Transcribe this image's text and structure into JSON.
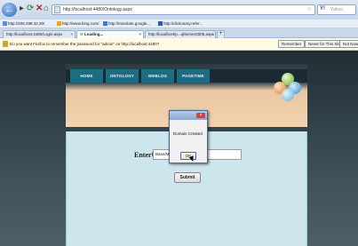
{
  "browser": {
    "url": "http://localhost:4480/Ontology.aspx",
    "search_placeholder": "Yahoo",
    "bookmarks": [
      {
        "label": "http://206.298.32.30/"
      },
      {
        "label": "http://www.bing.com/"
      },
      {
        "label": "http://translate.google..."
      },
      {
        "label": "http://dictionary.refer..."
      }
    ],
    "tabs": [
      {
        "label": "http://localhost:4480/Login.aspx"
      },
      {
        "label": "Loading..."
      },
      {
        "label": "http://localhost/p...qlServer2005.aspx"
      }
    ],
    "notification": {
      "text": "Do you want Firefox to remember the password for \"admin\" on http://localhost:4480?",
      "remember": "Remember",
      "ignore": "Never for This Site",
      "not_now": "Not Now"
    }
  },
  "site": {
    "nav": [
      "HOME",
      "ONTOLOGY",
      "WEBLOG",
      "PAGETIME"
    ],
    "form": {
      "label": "EnterUrl",
      "input_value": "Base/M                  SqlServer2005.aspx",
      "submit": "Submit"
    }
  },
  "dialog": {
    "message": "Domain Created",
    "ok_label": "OK"
  },
  "colors": {
    "nav_item": "#1c6d83",
    "page_dark": "#2a3840",
    "header_peach": "#f2d3b0",
    "panel": "#cde6ee"
  }
}
